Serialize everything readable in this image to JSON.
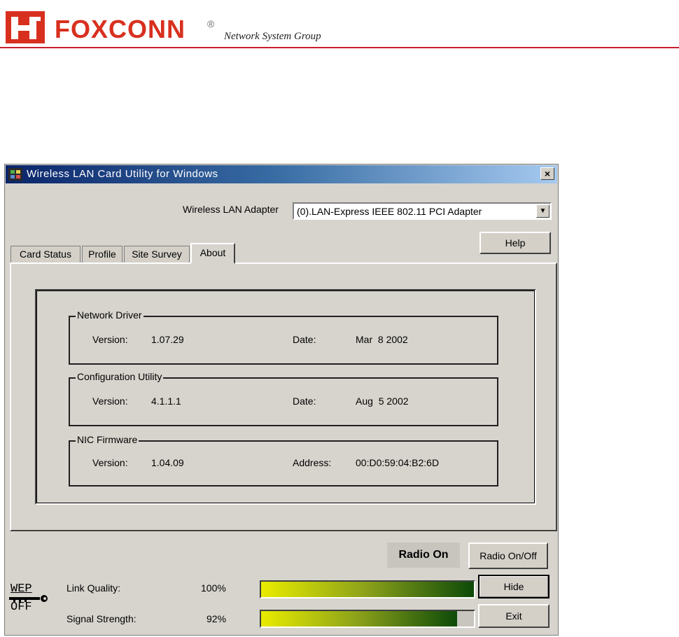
{
  "brand": {
    "name": "FOXCONN",
    "registered": "®",
    "subtitle": "Network System Group",
    "accent_color": "#d8301f"
  },
  "window": {
    "title": "Wireless LAN Card Utility for Windows",
    "close_label": "×",
    "adapter_label": "Wireless LAN Adapter",
    "adapter_value": "(0).LAN-Express IEEE 802.11 PCI Adapter",
    "help_label": "Help",
    "tabs": [
      {
        "label": "Card Status"
      },
      {
        "label": "Profile"
      },
      {
        "label": "Site Survey"
      },
      {
        "label": "About",
        "active": true
      }
    ],
    "about": {
      "network_driver": {
        "title": "Network Driver",
        "version_label": "Version:",
        "version": "1.07.29",
        "date_label": "Date:",
        "date": "Mar  8 2002"
      },
      "config_utility": {
        "title": "Configuration Utility",
        "version_label": "Version:",
        "version": "4.1.1.1",
        "date_label": "Date:",
        "date": "Aug  5 2002"
      },
      "nic_firmware": {
        "title": "NIC Firmware",
        "version_label": "Version:",
        "version": "1.04.09",
        "address_label": "Address:",
        "address": "00:D0:59:04:B2:6D"
      }
    },
    "radio_status": "Radio On",
    "radio_toggle_label": "Radio On/Off",
    "hide_label": "Hide",
    "exit_label": "Exit",
    "wep": {
      "line1": "WEP",
      "line2": "OFF"
    },
    "link_quality": {
      "label": "Link Quality:",
      "value_text": "100%",
      "value": 100
    },
    "signal_strength": {
      "label": "Signal Strength:",
      "value_text": "92%",
      "value": 92
    }
  }
}
